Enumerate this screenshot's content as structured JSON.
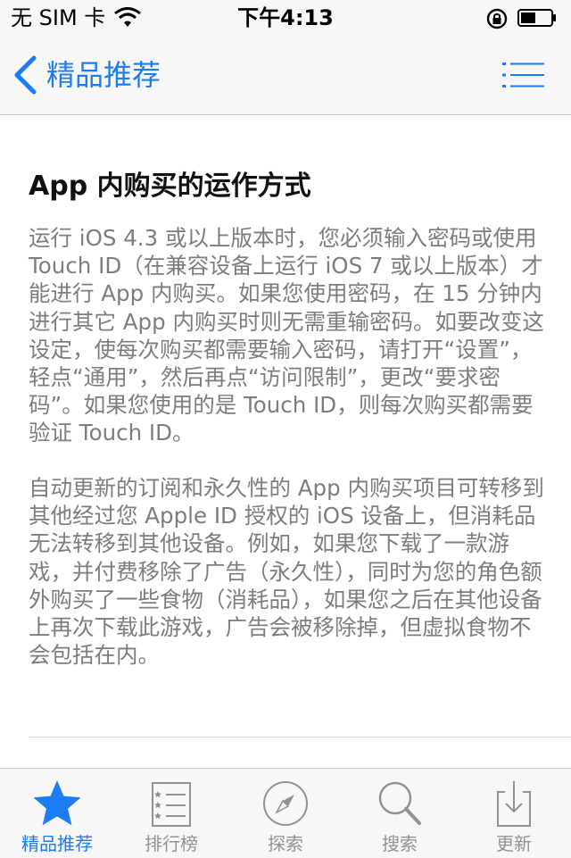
{
  "status_bar": {
    "carrier": "无 SIM 卡",
    "time": "下午4:13"
  },
  "nav": {
    "back_label": "精品推荐",
    "back_icon": "chevron-left-icon",
    "list_icon": "list-icon",
    "accent_color": "#1b7cf4"
  },
  "article": {
    "title": "App 内购买的运作方式",
    "paragraph_1": "运行 iOS 4.3 或以上版本时，您必须输入密码或使用 Touch ID（在兼容设备上运行 iOS 7 或以上版本）才能进行 App 内购买。如果您使用密码，在 15 分钟内进行其它 App 内购买时则无需重输密码。如要改变这设定，使每次购买都需要输入密码，请打开“设置”，轻点“通用”，然后再点“访问限制”，更改“要求密码”。如果您使用的是 Touch ID，则每次购买都需要验证 Touch ID。",
    "paragraph_2": "自动更新的订阅和永久性的 App 内购买项目可转移到其他经过您 Apple ID 授权的 iOS 设备上，但消耗品无法转移到其他设备。例如，如果您下载了一款游戏，并付费移除了广告（永久性），同时为您的角色额外购买了一些食物（消耗品），如果您之后在其他设备上再次下载此游戏，广告会被移除掉，但虚拟食物不会包括在内。"
  },
  "tabs": [
    {
      "label": "精品推荐",
      "icon": "star-icon",
      "active": true
    },
    {
      "label": "排行榜",
      "icon": "ranking-list-icon",
      "active": false
    },
    {
      "label": "探索",
      "icon": "compass-icon",
      "active": false
    },
    {
      "label": "搜索",
      "icon": "search-icon",
      "active": false
    },
    {
      "label": "更新",
      "icon": "download-tray-icon",
      "active": false
    }
  ],
  "colors": {
    "tab_inactive": "#929292",
    "body_text": "#7d7d7d"
  }
}
